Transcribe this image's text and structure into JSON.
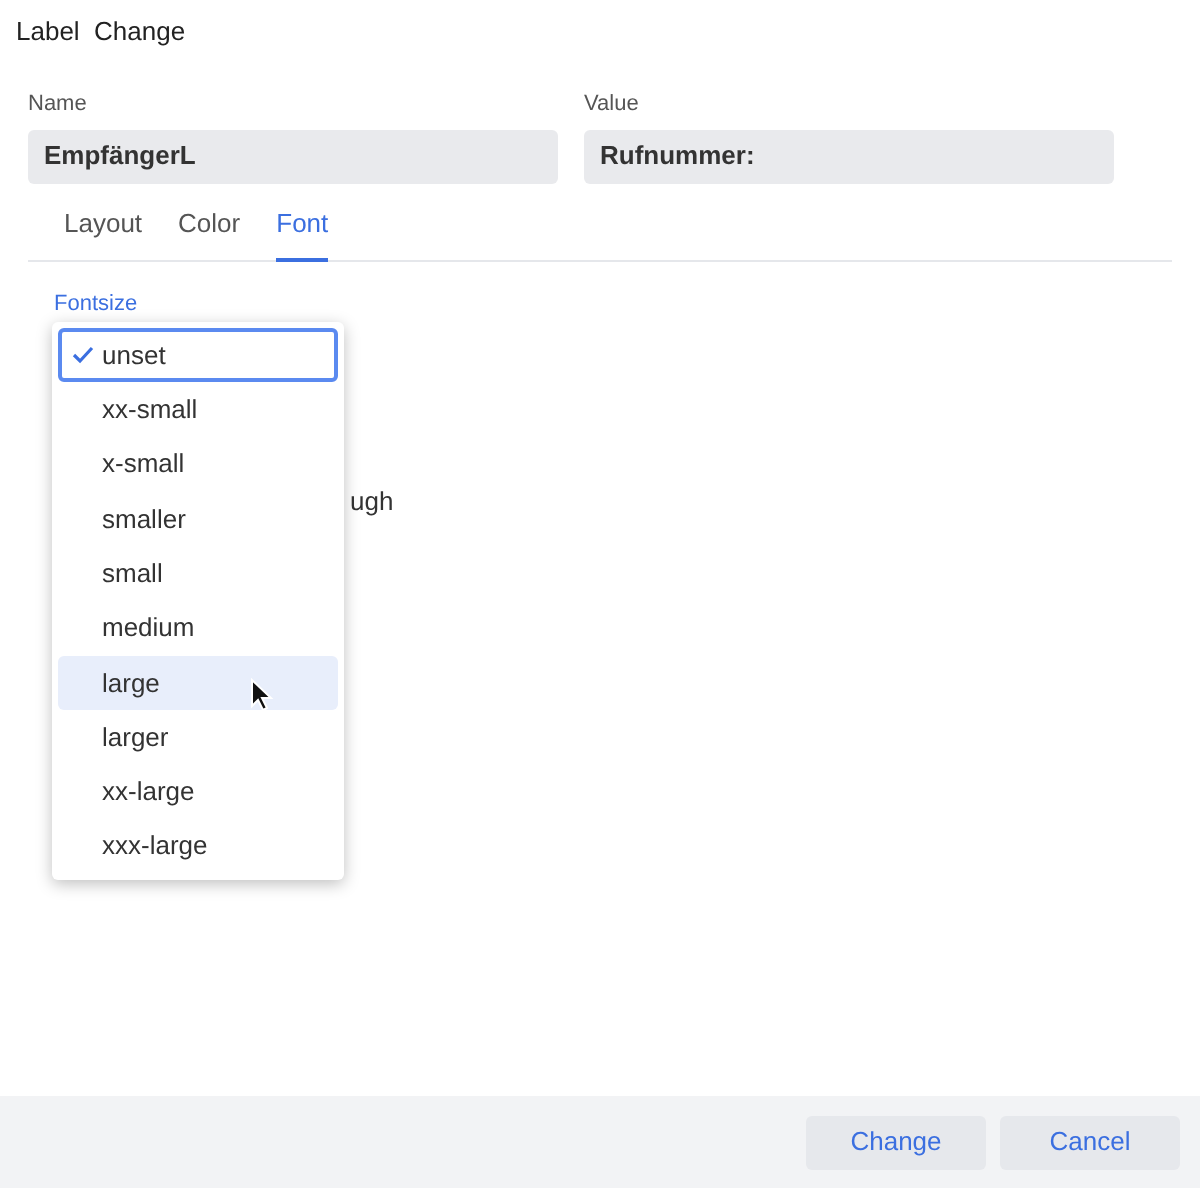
{
  "window": {
    "title": "Label  Change"
  },
  "fields": [
    {
      "label": "Name",
      "value": "EmpfängerL"
    },
    {
      "label": "Value",
      "value": "Rufnummer:"
    }
  ],
  "tabs": [
    {
      "label": "Layout",
      "selected": false
    },
    {
      "label": "Color",
      "selected": false
    },
    {
      "label": "Font",
      "selected": true
    }
  ],
  "fontsize": {
    "label": "Fontsize",
    "hidden_text": "ugh",
    "options": [
      {
        "label": "unset",
        "selected": true,
        "hovered": false
      },
      {
        "label": "xx-small",
        "selected": false,
        "hovered": false
      },
      {
        "label": "x-small",
        "selected": false,
        "hovered": false
      },
      {
        "label": "smaller",
        "selected": false,
        "hovered": false
      },
      {
        "label": "small",
        "selected": false,
        "hovered": false
      },
      {
        "label": "medium",
        "selected": false,
        "hovered": false
      },
      {
        "label": "large",
        "selected": false,
        "hovered": true
      },
      {
        "label": "larger",
        "selected": false,
        "hovered": false
      },
      {
        "label": "xx-large",
        "selected": false,
        "hovered": false
      },
      {
        "label": "xxx-large",
        "selected": false,
        "hovered": false
      }
    ]
  },
  "buttons": [
    "Change",
    "Cancel"
  ]
}
